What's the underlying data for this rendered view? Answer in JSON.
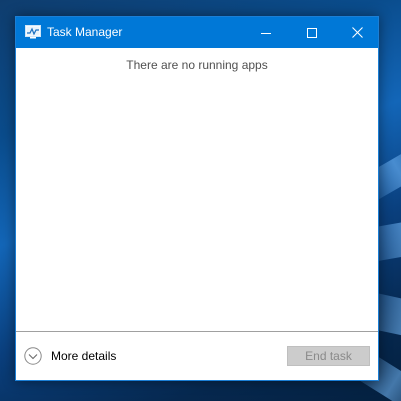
{
  "window": {
    "title": "Task Manager",
    "icon": "task-manager-icon",
    "accent_color": "#0078d7"
  },
  "caption_buttons": {
    "minimize": "minimize-icon",
    "maximize": "maximize-icon",
    "close": "close-icon"
  },
  "content": {
    "empty_message": "There are no running apps"
  },
  "footer": {
    "more_details_label": "More details",
    "more_details_icon": "chevron-down-circle-icon",
    "end_task_label": "End task",
    "end_task_enabled": false
  }
}
